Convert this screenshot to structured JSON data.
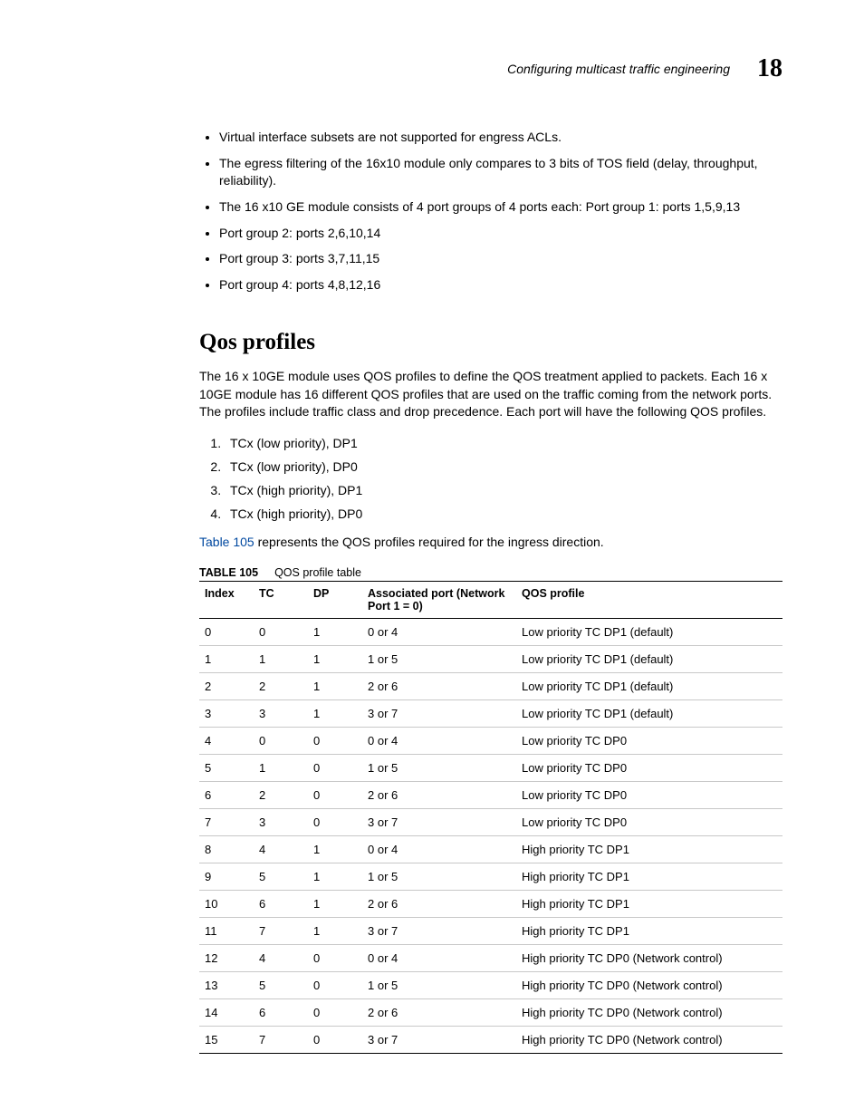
{
  "running_header": {
    "title": "Configuring multicast traffic engineering",
    "chapter": "18"
  },
  "bullets": [
    "Virtual interface subsets are not supported for engress ACLs.",
    "The egress filtering of the 16x10 module only compares to 3 bits of TOS field (delay, throughput, reliability).",
    "The 16 x10 GE module consists of 4 port groups of 4 ports each: Port group 1: ports 1,5,9,13",
    "Port group 2: ports 2,6,10,14",
    "Port group 3: ports 3,7,11,15",
    "Port group 4: ports 4,8,12,16"
  ],
  "section_heading": "Qos profiles",
  "intro_paragraph": "The 16 x 10GE module uses QOS profiles to define the QOS treatment applied to packets.  Each 16 x 10GE module has 16 different QOS profiles that are used on the traffic coming from the network ports.  The profiles include traffic class and drop precedence.  Each port will have the following QOS profiles.",
  "ordered": [
    "TCx (low priority), DP1",
    "TCx (low priority), DP0",
    "TCx (high priority), DP1",
    "TCx (high priority), DP0"
  ],
  "xref_sentence": {
    "link": "Table 105",
    "rest": " represents the QOS profiles required for the ingress direction."
  },
  "table_caption": {
    "label": "TABLE 105",
    "title": "QOS profile table"
  },
  "table_headers": {
    "index": "Index",
    "tc": "TC",
    "dp": "DP",
    "assoc": "Associated port (Network Port 1 = 0)",
    "qos": "QOS profile"
  },
  "chart_data": {
    "type": "table",
    "title": "QOS profile table",
    "columns": [
      "Index",
      "TC",
      "DP",
      "Associated port (Network Port 1 = 0)",
      "QOS profile"
    ],
    "rows": [
      [
        "0",
        "0",
        "1",
        "0 or 4",
        "Low priority TC DP1 (default)"
      ],
      [
        "1",
        "1",
        "1",
        "1 or 5",
        "Low priority TC DP1 (default)"
      ],
      [
        "2",
        "2",
        "1",
        "2 or 6",
        "Low priority TC DP1 (default)"
      ],
      [
        "3",
        "3",
        "1",
        "3 or 7",
        "Low priority TC DP1 (default)"
      ],
      [
        "4",
        "0",
        "0",
        "0 or 4",
        "Low priority TC DP0"
      ],
      [
        "5",
        "1",
        "0",
        "1 or 5",
        "Low priority TC DP0"
      ],
      [
        "6",
        "2",
        "0",
        "2 or 6",
        "Low priority TC DP0"
      ],
      [
        "7",
        "3",
        "0",
        "3 or 7",
        "Low priority TC DP0"
      ],
      [
        "8",
        "4",
        "1",
        "0 or 4",
        "High priority TC DP1"
      ],
      [
        "9",
        "5",
        "1",
        "1 or 5",
        "High priority TC DP1"
      ],
      [
        "10",
        "6",
        "1",
        "2 or 6",
        "High priority TC DP1"
      ],
      [
        "11",
        "7",
        "1",
        "3 or 7",
        "High priority TC DP1"
      ],
      [
        "12",
        "4",
        "0",
        "0 or 4",
        "High priority TC DP0 (Network control)"
      ],
      [
        "13",
        "5",
        "0",
        "1 or 5",
        "High priority TC DP0 (Network control)"
      ],
      [
        "14",
        "6",
        "0",
        "2 or 6",
        "High priority TC DP0 (Network control)"
      ],
      [
        "15",
        "7",
        "0",
        "3 or 7",
        "High priority TC DP0 (Network control)"
      ]
    ]
  }
}
